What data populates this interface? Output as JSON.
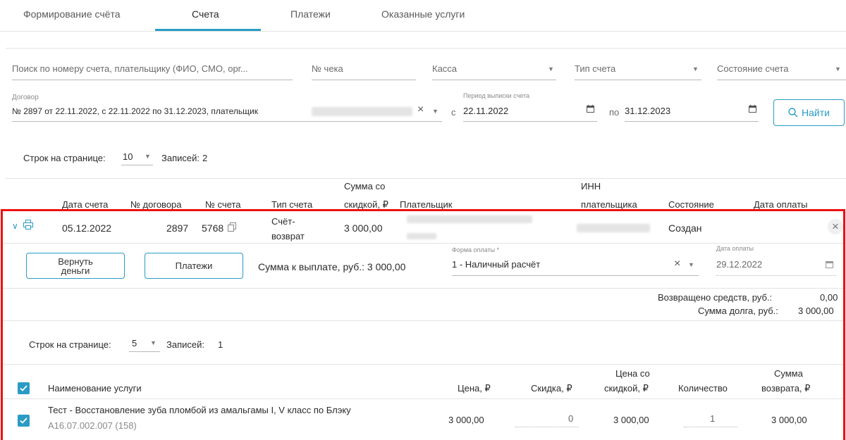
{
  "tabs": [
    {
      "label": "Формирование счёта"
    },
    {
      "label": "Счета"
    },
    {
      "label": "Платежи"
    },
    {
      "label": "Оказанные услуги"
    }
  ],
  "filters": {
    "search_placeholder": "Поиск по номеру счета, плательщику (ФИО, СМО, орг...",
    "check_placeholder": "№ чека",
    "cash_placeholder": "Касса",
    "invoice_type_placeholder": "Тип счета",
    "invoice_state_placeholder": "Состояние счета",
    "contract_label": "Договор",
    "contract_value": "№ 2897 от 22.11.2022, с 22.11.2022 по 31.12.2023, плательщик",
    "period_label": "Период выписки счета",
    "from_prefix": "с",
    "date_from": "22.11.2022",
    "to_prefix": "по",
    "date_to": "31.12.2023",
    "find_label": "Найти"
  },
  "pagination": {
    "rows_label": "Строк на странице:",
    "rows_value": "10",
    "records_label": "Записей:",
    "records_value": "2"
  },
  "table": {
    "headers": {
      "date": "Дата счета",
      "contract": "№ договора",
      "number": "№ счета",
      "type": "Тип счета",
      "sum_line1": "Сумма со",
      "sum_line2": "скидкой, ₽",
      "payer": "Плательщик",
      "inn_line1": "ИНН",
      "inn_line2": "плательщика",
      "state": "Состояние",
      "pay_date": "Дата оплаты"
    },
    "row": {
      "date": "05.12.2022",
      "contract": "2897",
      "number": "5768",
      "type_line1": "Счёт-",
      "type_line2": "возврат",
      "sum": "3 000,00",
      "state": "Создан"
    }
  },
  "detail": {
    "refund_btn_line1": "Вернуть",
    "refund_btn_line2": "деньги",
    "payments_btn": "Платежи",
    "to_pay": "Сумма к выплате, руб.: 3 000,00",
    "pay_form_label": "Форма оплаты *",
    "pay_form_value": "1 - Наличный расчёт",
    "pay_date_label": "Дата оплаты",
    "pay_date_value": "29.12.2022",
    "returned_label": "Возвращено средств, руб.:",
    "returned_value": "0,00",
    "debt_label": "Сумма долга, руб.:",
    "debt_value": "3 000,00",
    "pagination": {
      "rows_label": "Строк на странице:",
      "rows_value": "5",
      "records_label": "Записей:",
      "records_value": "1"
    },
    "services": {
      "headers": {
        "name": "Наименование услуги",
        "price": "Цена, ₽",
        "discount": "Скидка, ₽",
        "disc_price_line1": "Цена со",
        "disc_price_line2": "скидкой, ₽",
        "quantity": "Количество",
        "refund_line1": "Сумма",
        "refund_line2": "возврата, ₽"
      },
      "rows": [
        {
          "name": "Тест - Восстановление зуба пломбой из амальгамы I, V класс по Блэку",
          "code": "A16.07.002.007 (158)",
          "price": "3 000,00",
          "discount": "0",
          "disc_price": "3 000,00",
          "quantity": "1",
          "refund": "3 000,00"
        }
      ]
    }
  },
  "colors": {
    "accent": "#2a9bc4",
    "highlight_border": "#ee1111"
  }
}
